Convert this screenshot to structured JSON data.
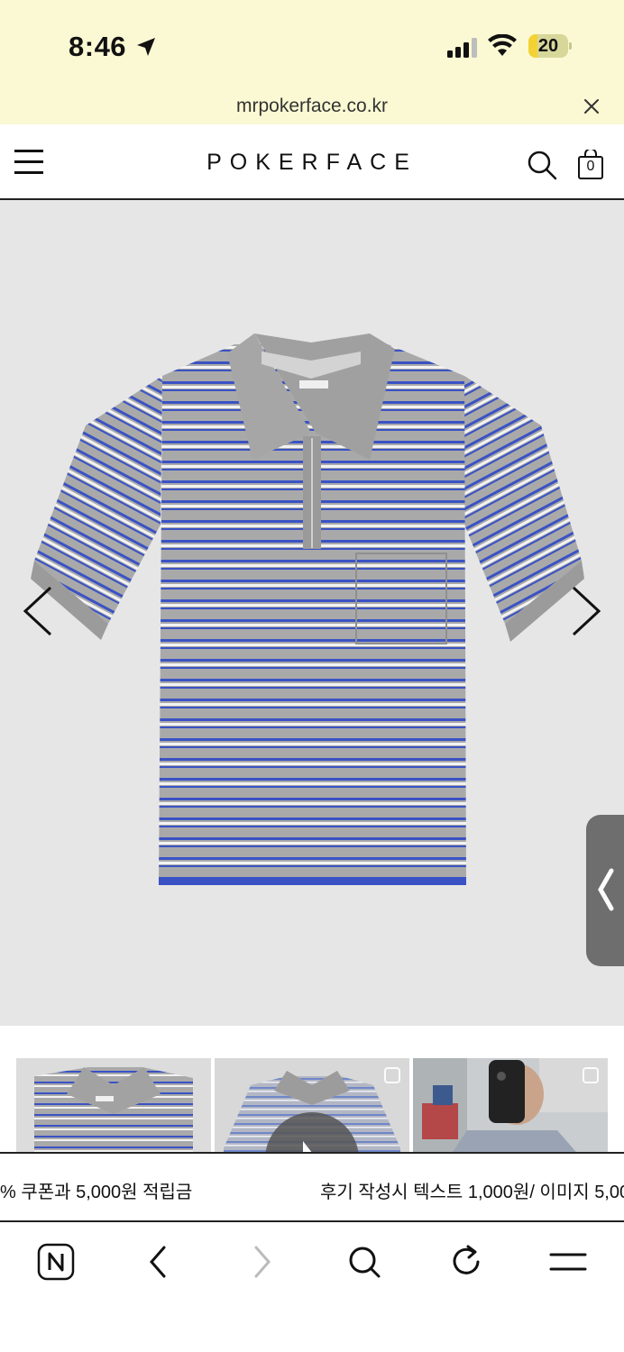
{
  "status_bar": {
    "time": "8:46",
    "battery": "20",
    "icons": [
      "location-arrow-icon",
      "cellular-signal-icon",
      "wifi-icon",
      "battery-icon"
    ]
  },
  "browser": {
    "url": "mrpokerface.co.kr",
    "close_icon": "close-icon"
  },
  "site_header": {
    "logo": "POKERFACE",
    "cart_count": "0",
    "icons": [
      "hamburger-menu-icon",
      "search-icon",
      "shopping-bag-icon"
    ]
  },
  "product_gallery": {
    "description_icon": "product-shirt-image",
    "prev_icon": "chevron-left-icon",
    "next_icon": "chevron-right-icon",
    "side_tab_icon": "chevron-left-icon"
  },
  "thumbnails": [
    {
      "name": "packaged-shirt-thumb"
    },
    {
      "name": "video-thumb",
      "icon": "play-icon"
    },
    {
      "name": "mirror-selfie-thumb"
    }
  ],
  "marquee": {
    "text_a": "% 쿠폰과 5,000원 적립금",
    "text_b": "후기 작성시 텍스트 1,000원/ 이미지 5,00"
  },
  "toolbar": {
    "icons": [
      "naver-n-icon",
      "back-icon",
      "forward-icon",
      "search-icon",
      "reload-icon",
      "menu-icon"
    ]
  },
  "colors": {
    "status_bg": "#fbf9d3",
    "hero_bg": "#e6e6e6",
    "stripe_blue": "#3a52c4",
    "shirt_grey": "#a9a9a9"
  }
}
